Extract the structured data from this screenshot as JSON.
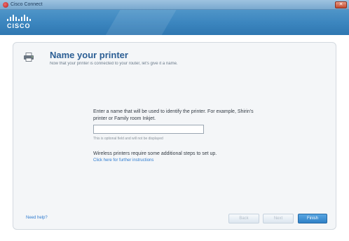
{
  "window": {
    "title": "Cisco Connect",
    "close_symbol": "✕"
  },
  "brand": {
    "logo_text": "CISCO"
  },
  "page": {
    "title": "Name your printer",
    "subtitle": "Now that your printer is connected to your router, let's give it a name."
  },
  "form": {
    "instruction": "Enter a name that will be used to identify the printer. For example, Shirin's printer or Family room Inkjet.",
    "name_value": "",
    "name_placeholder": "",
    "helper_text": "This is optional field and will not be displayed"
  },
  "wireless": {
    "note": "Wireless printers require some additional steps to set up.",
    "link": "Click here for further instructions"
  },
  "footer": {
    "help_link": "Need help?",
    "back_label": "Back",
    "next_label": "Next",
    "finish_label": "Finish"
  },
  "colors": {
    "header_blue": "#3c86bf",
    "title_blue": "#2b5e94",
    "link_blue": "#2e7bcf",
    "finish_button": "#2f80c6"
  },
  "icons": {
    "app": "cisco-app-icon",
    "printer": "printer-icon",
    "close": "close-icon"
  }
}
